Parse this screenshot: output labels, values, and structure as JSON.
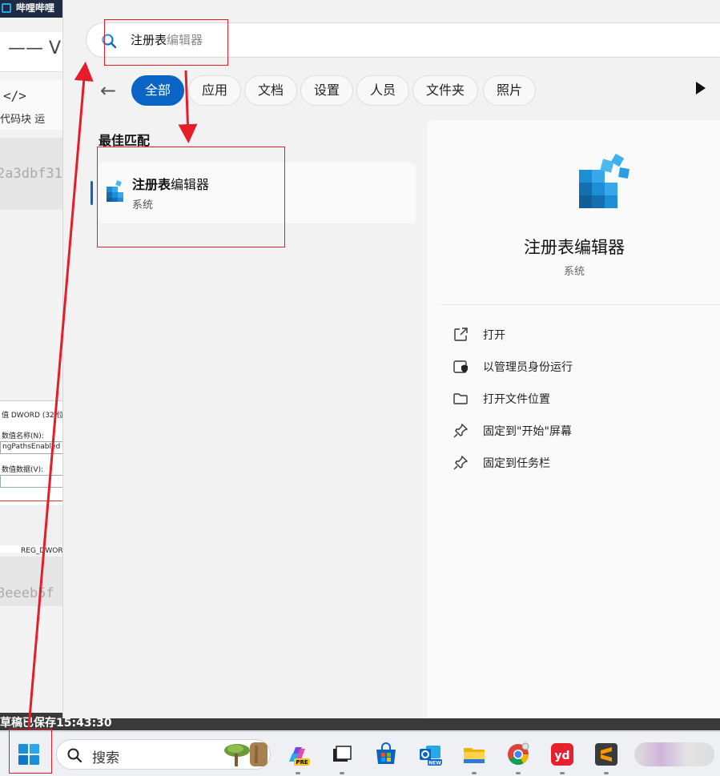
{
  "background_window": {
    "title": "哔哩哔哩",
    "heading": "—— V",
    "toolbar_code_icon": "</>",
    "toolbar_label": "代码块  运",
    "hash_1": "2a3dbf31",
    "hash_2": "8eeeb5f",
    "dialog_lines": [
      "值 DWORD (32 位)值",
      "数值名称(N):",
      "ngPathsEnabled",
      "数值数据(V):",
      "REG_DWORD"
    ],
    "status": "草稿已保存15:43:30"
  },
  "search": {
    "typed": "注册表",
    "suggested": "编辑器"
  },
  "filters": {
    "back_icon": "arrow-left-icon",
    "tabs": [
      "全部",
      "应用",
      "文档",
      "设置",
      "人员",
      "文件夹",
      "照片"
    ],
    "active": "全部",
    "more_icon": "play-icon"
  },
  "results": {
    "section_title": "最佳匹配",
    "best": {
      "name_bold": "注册表",
      "name_rest": "编辑器",
      "type": "系统"
    }
  },
  "detail": {
    "name": "注册表编辑器",
    "type": "系统",
    "actions": [
      {
        "label": "打开",
        "icon": "open-external-icon"
      },
      {
        "label": "以管理员身份运行",
        "icon": "shield-run-icon"
      },
      {
        "label": "打开文件位置",
        "icon": "folder-icon"
      },
      {
        "label": "固定到\"开始\"屏幕",
        "icon": "pin-icon"
      },
      {
        "label": "固定到任务栏",
        "icon": "pin-icon"
      }
    ]
  },
  "taskbar": {
    "search_placeholder": "搜索",
    "apps": [
      "copilot-pre",
      "task-view",
      "microsoft-store",
      "outlook-new",
      "file-explorer",
      "chrome",
      "youdao",
      "sublime-text",
      "blurred-apps"
    ]
  },
  "colors": {
    "accent": "#0a64c4",
    "annotation": "#e51d2a",
    "regedit_blue": "#1a8fd6"
  }
}
